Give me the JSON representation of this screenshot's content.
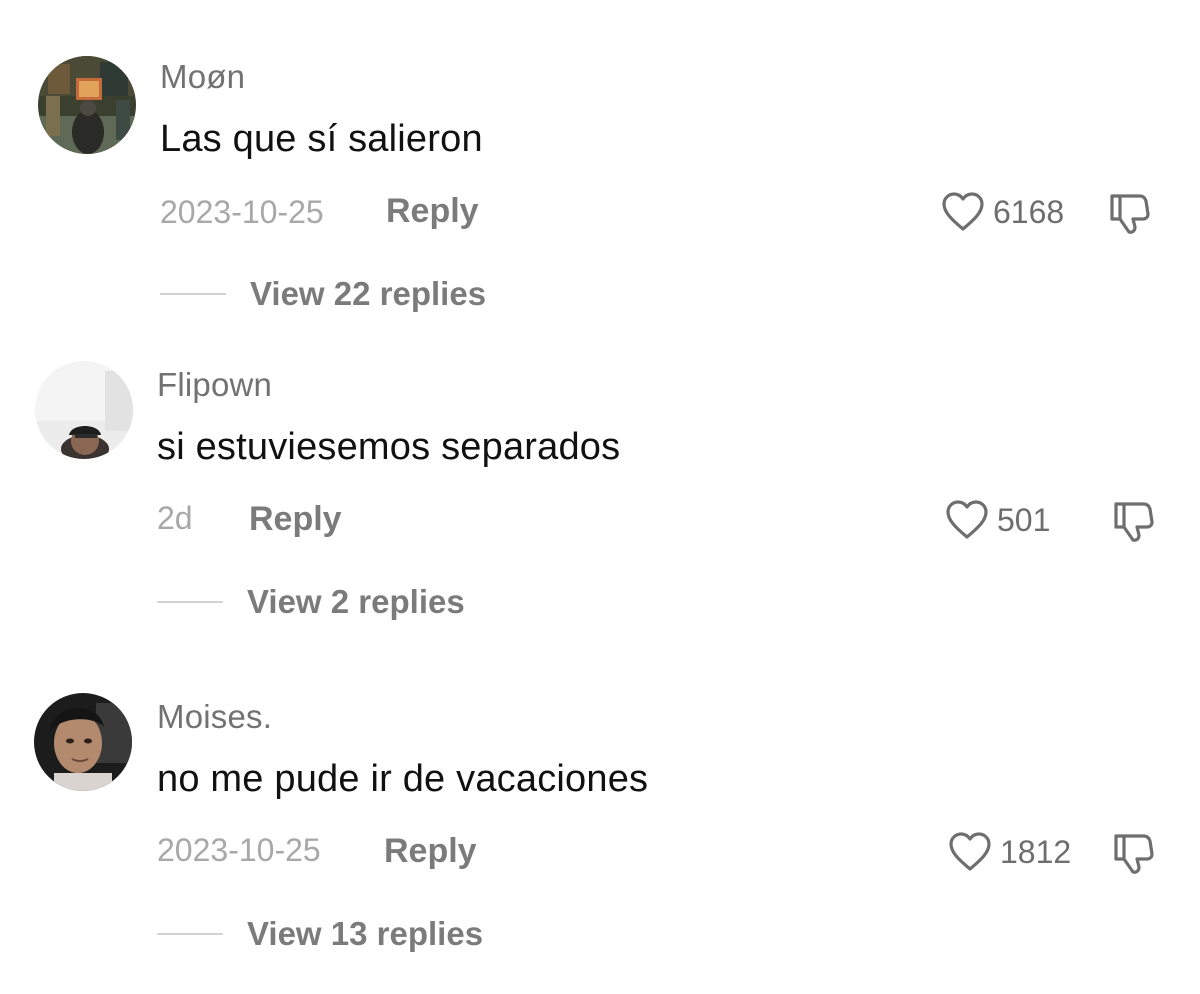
{
  "comments": [
    {
      "username": "Moøn",
      "text": "Las que sí salieron",
      "date": "2023-10-25",
      "reply_label": "Reply",
      "likes": "6168",
      "view_replies": "View 22 replies"
    },
    {
      "username": "Flipown",
      "text": "si estuviesemos separados",
      "date": "2d",
      "reply_label": "Reply",
      "likes": "501",
      "view_replies": "View 2 replies"
    },
    {
      "username": "Moises.",
      "text": "no me pude ir de vacaciones",
      "date": "2023-10-25",
      "reply_label": "Reply",
      "likes": "1812",
      "view_replies": "View 13 replies"
    }
  ],
  "icons": {
    "like": "heart-outline-icon",
    "dislike": "thumbs-down-outline-icon"
  },
  "colors": {
    "background": "#ffffff",
    "username": "#727272",
    "comment_text": "#111111",
    "meta": "#a8a8a8",
    "action": "#7b7b7b"
  }
}
